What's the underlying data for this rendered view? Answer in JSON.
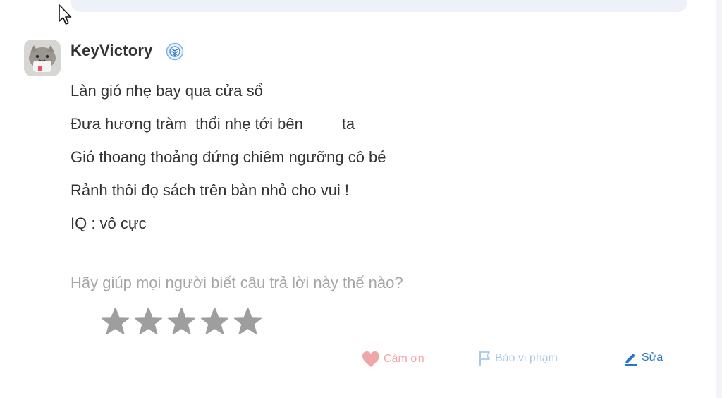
{
  "answer": {
    "user": {
      "name": "KeyVictory",
      "badge_icon": "verified-badge-icon"
    },
    "lines": [
      "Làn gió nhẹ bay qua cửa sổ",
      "Đưa hương tràm  thổi nhẹ tới bên         ta",
      "Gió thoang thoảng đứng chiêm ngưỡng cô bé",
      "Rảnh thôi đọ sách trên bàn nhỏ cho vui !",
      "IQ : vô cực"
    ]
  },
  "rating": {
    "prompt": "Hãy giúp mọi người biết câu trả lời này thế nào?",
    "max_stars": 5,
    "filled_stars": 0,
    "star_color": "#9e9e9e"
  },
  "actions": {
    "thanks_label": "Cám ơn",
    "report_label": "Báo vi phạm",
    "edit_label": "Sửa"
  },
  "colors": {
    "thanks": "#f0a7a7",
    "report": "#a9c9ea",
    "edit": "#2c74c9",
    "text": "#333333",
    "muted": "#a6a6a6"
  }
}
